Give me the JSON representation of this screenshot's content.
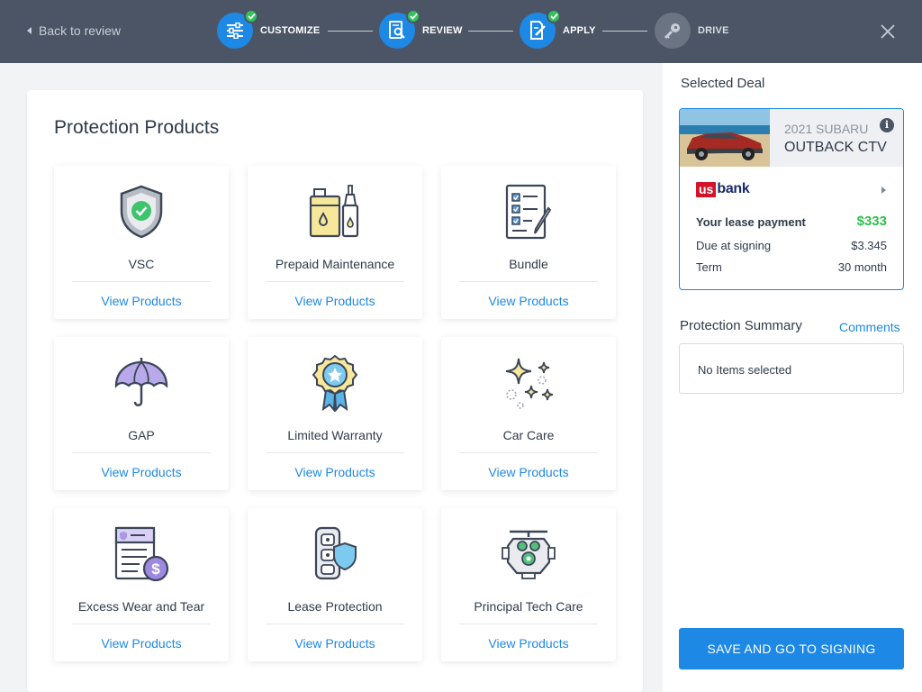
{
  "header": {
    "back_label": "Back to review",
    "steps": [
      {
        "label": "CUSTOMIZE",
        "icon": "sliders-icon",
        "done": true
      },
      {
        "label": "REVIEW",
        "icon": "document-search-icon",
        "done": true
      },
      {
        "label": "APPLY",
        "icon": "document-edit-icon",
        "done": true
      },
      {
        "label": "DRIVE",
        "icon": "key-icon",
        "done": false
      }
    ],
    "close_icon": "close-icon",
    "colors": {
      "bar": "#4b5566",
      "active": "#1e88e5",
      "check": "#33c25b"
    }
  },
  "protection": {
    "title": "Protection Products",
    "view_label": "View Products",
    "products": [
      {
        "name": "VSC",
        "icon": "shield-check-icon"
      },
      {
        "name": "Prepaid Maintenance",
        "icon": "oil-bottles-icon"
      },
      {
        "name": "Bundle",
        "icon": "checklist-icon"
      },
      {
        "name": "GAP",
        "icon": "umbrella-icon"
      },
      {
        "name": "Limited Warranty",
        "icon": "award-ribbon-icon"
      },
      {
        "name": "Car Care",
        "icon": "sparkles-icon"
      },
      {
        "name": "Excess Wear and Tear",
        "icon": "document-dollar-icon"
      },
      {
        "name": "Lease Protection",
        "icon": "key-fob-shield-icon"
      },
      {
        "name": "Principal Tech Care",
        "icon": "engine-icon"
      }
    ]
  },
  "deal": {
    "title": "Selected Deal",
    "year_make": "2021 SUBARU",
    "model": "OUTBACK CTV",
    "bank_us": "us",
    "bank_name": "bank",
    "lease_payment_label": "Your lease payment",
    "lease_payment_value": "$333",
    "due_label": "Due at signing",
    "due_value": "$3.345",
    "term_label": "Term",
    "term_value": "30 month"
  },
  "summary": {
    "title": "Protection Summary",
    "comments_label": "Comments",
    "empty_text": "No Items selected"
  },
  "actions": {
    "save_label": "SAVE AND GO TO SIGNING"
  }
}
